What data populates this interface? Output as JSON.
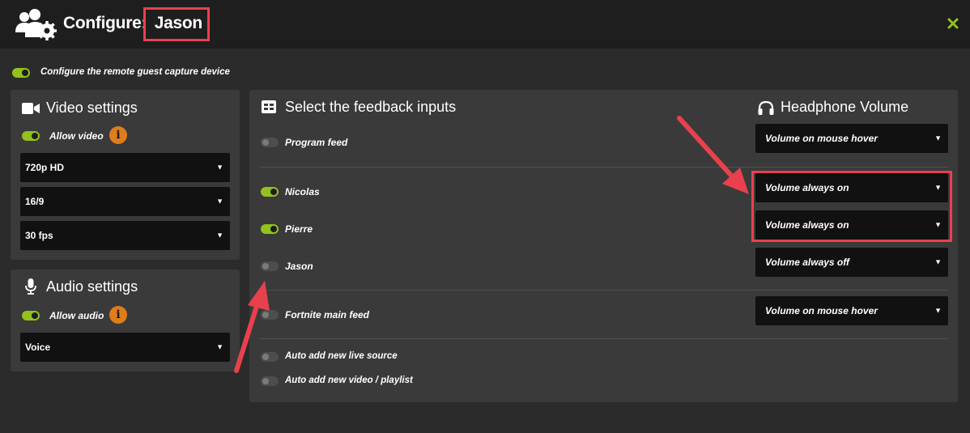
{
  "header": {
    "title_prefix": "Configure:",
    "guest_name": "Jason"
  },
  "remote_capture": {
    "label": "Configure the remote guest capture device",
    "enabled": true
  },
  "video_settings": {
    "title": "Video settings",
    "allow_label": "Allow video",
    "allow_enabled": true,
    "resolution": "720p HD",
    "aspect": "16/9",
    "framerate": "30 fps"
  },
  "audio_settings": {
    "title": "Audio settings",
    "allow_label": "Allow audio",
    "allow_enabled": true,
    "mode": "Voice"
  },
  "feedback": {
    "title": "Select the feedback inputs",
    "headphone_title": "Headphone Volume",
    "inputs": [
      {
        "label": "Program feed",
        "enabled": false,
        "volume": "Volume on mouse hover"
      },
      {
        "label": "Nicolas",
        "enabled": true,
        "volume": "Volume always on"
      },
      {
        "label": "Pierre",
        "enabled": true,
        "volume": "Volume always on"
      },
      {
        "label": "Jason",
        "enabled": false,
        "volume": "Volume always off"
      },
      {
        "label": "Fortnite main feed",
        "enabled": false,
        "volume": "Volume on mouse hover"
      }
    ],
    "auto_options": [
      {
        "label": "Auto add new live source",
        "enabled": false
      },
      {
        "label": "Auto add new video / playlist",
        "enabled": false
      }
    ]
  },
  "colors": {
    "accent_green": "#93c11d",
    "highlight_red": "#e8414d",
    "info_orange": "#e07d1b"
  },
  "icons": {
    "title": "users-gear-icon",
    "close": "close-icon",
    "video": "video-camera-icon",
    "audio": "microphone-icon",
    "feedback": "grid-icon",
    "headphone": "headphones-icon",
    "info": "info-icon"
  }
}
